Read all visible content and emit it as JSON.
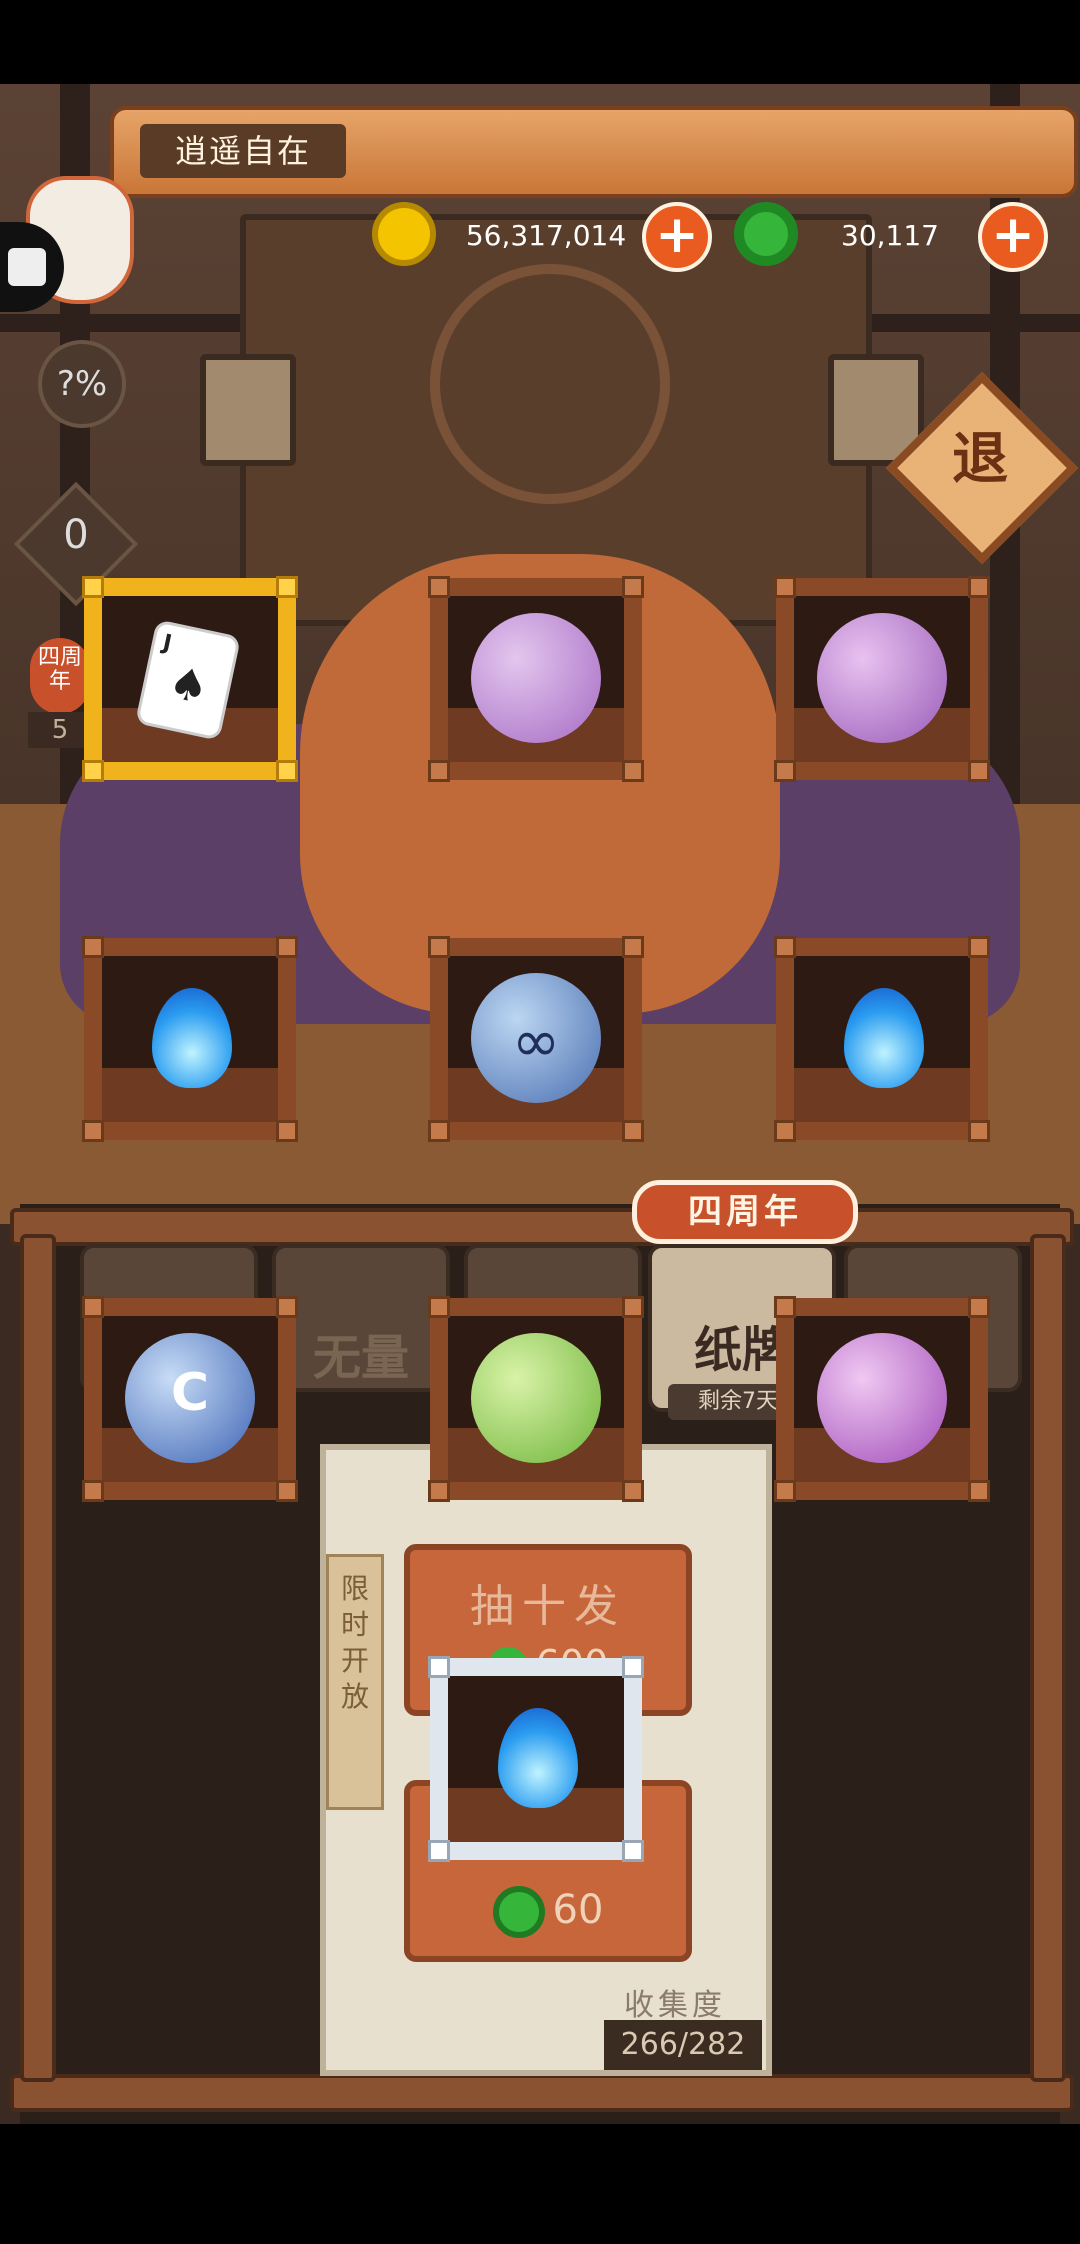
{
  "player": {
    "name": "逍遥自在"
  },
  "currency": {
    "gold": {
      "value": "56,317,014",
      "color": "#f5c400"
    },
    "jade": {
      "value": "30,117",
      "color": "#35b53a"
    }
  },
  "side": {
    "percent_label": "?%",
    "counter_value": "0",
    "anniv_badge": "四周年",
    "partial_count": "5"
  },
  "exit_label": "退",
  "banner": {
    "title": "四周年"
  },
  "tabs": [
    {
      "label": "无量"
    },
    {
      "label": "纸牌",
      "sublabel": "剩余7天"
    }
  ],
  "limited_tag": "限时开放",
  "draw_ten": {
    "label": "抽十发",
    "cost": "600"
  },
  "draw_one": {
    "cost": "60"
  },
  "collection": {
    "label": "收集度",
    "value": "266/282"
  },
  "items": [
    {
      "icon": "spade-jack-card-icon"
    },
    {
      "icon": "purple-carpet-orb-icon"
    },
    {
      "icon": "demon-mask-orb-icon"
    },
    {
      "icon": "blue-flame-icon"
    },
    {
      "icon": "infinity-orb-icon"
    },
    {
      "icon": "blue-flame-icon"
    },
    {
      "icon": "crescent-badge-orb-icon"
    },
    {
      "icon": "green-creature-orb-icon"
    },
    {
      "icon": "owl-eye-orb-icon"
    },
    {
      "icon": "blue-flame-icon"
    }
  ]
}
